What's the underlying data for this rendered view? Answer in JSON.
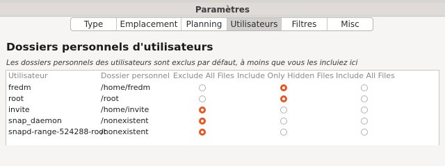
{
  "window": {
    "title": "Paramètres"
  },
  "tabs": [
    {
      "label": "Type",
      "active": false
    },
    {
      "label": "Emplacement",
      "active": false
    },
    {
      "label": "Planning",
      "active": false
    },
    {
      "label": "Utilisateurs",
      "active": true
    },
    {
      "label": "Filtres",
      "active": false
    },
    {
      "label": "Misc",
      "active": false
    }
  ],
  "section": {
    "heading": "Dossiers personnels d'utilisateurs",
    "description": "Les dossiers personnels des utilisateurs sont exclus par défaut, à moins que vous les incluiez ici"
  },
  "table": {
    "columns": {
      "user": "Utilisateur",
      "home": "Dossier personnel",
      "exclude_all": "Exclude All Files",
      "include_hidden": "Include Only Hidden Files",
      "include_all": "Include All Files"
    },
    "rows": [
      {
        "user": "fredm",
        "home": "/home/fredm",
        "selected": "include_hidden"
      },
      {
        "user": "root",
        "home": "/root",
        "selected": "include_hidden"
      },
      {
        "user": "invite",
        "home": "/home/invite",
        "selected": "exclude_all"
      },
      {
        "user": "snap_daemon",
        "home": "/nonexistent",
        "selected": "exclude_all"
      },
      {
        "user": "snapd-range-524288-root",
        "home": "/nonexistent",
        "selected": "exclude_all"
      }
    ]
  },
  "colors": {
    "accent": "#e95420",
    "titlebar": "#dedbd8",
    "active_tab": "#d2d0cd"
  }
}
